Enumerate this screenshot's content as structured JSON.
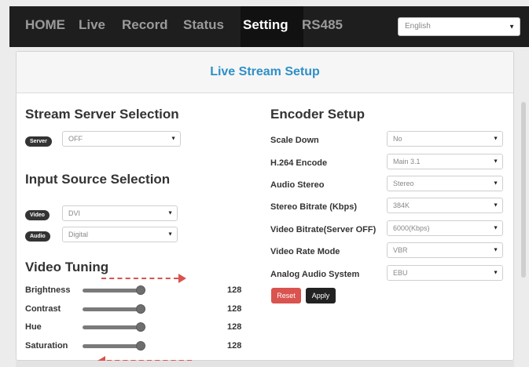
{
  "nav": {
    "items": [
      {
        "label": "HOME",
        "active": false
      },
      {
        "label": "Live",
        "active": false
      },
      {
        "label": "Record",
        "active": false
      },
      {
        "label": "Status",
        "active": false
      },
      {
        "label": "Setting",
        "active": true
      },
      {
        "label": "RS485",
        "active": false
      }
    ],
    "language": "English"
  },
  "panel": {
    "title": "Live Stream Setup"
  },
  "stream_server": {
    "heading": "Stream Server Selection",
    "badge": "Server",
    "value": "OFF"
  },
  "input_source": {
    "heading": "Input Source Selection",
    "video_badge": "Video",
    "video_value": "DVI",
    "audio_badge": "Audio",
    "audio_value": "Digital"
  },
  "video_tuning": {
    "heading": "Video Tuning",
    "sliders": [
      {
        "label": "Brightness",
        "value": "128"
      },
      {
        "label": "Contrast",
        "value": "128"
      },
      {
        "label": "Hue",
        "value": "128"
      },
      {
        "label": "Saturation",
        "value": "128"
      }
    ]
  },
  "encoder": {
    "heading": "Encoder Setup",
    "rows": [
      {
        "label": "Scale Down",
        "value": "No"
      },
      {
        "label": "H.264 Encode",
        "value": "Main 3.1"
      },
      {
        "label": "Audio Stereo",
        "value": "Stereo"
      },
      {
        "label": "Stereo Bitrate (Kbps)",
        "value": "384K"
      },
      {
        "label": "Video Bitrate(Server OFF)",
        "value": "6000(Kbps)"
      },
      {
        "label": "Video Rate Mode",
        "value": "VBR"
      },
      {
        "label": "Analog Audio System",
        "value": "EBU"
      }
    ],
    "reset_label": "Reset",
    "apply_label": "Apply"
  },
  "colors": {
    "navbar": "#1e1e1e",
    "title_blue": "#2f8fc6",
    "reset_red": "#d9534f",
    "arrow_red": "#d9534f"
  }
}
